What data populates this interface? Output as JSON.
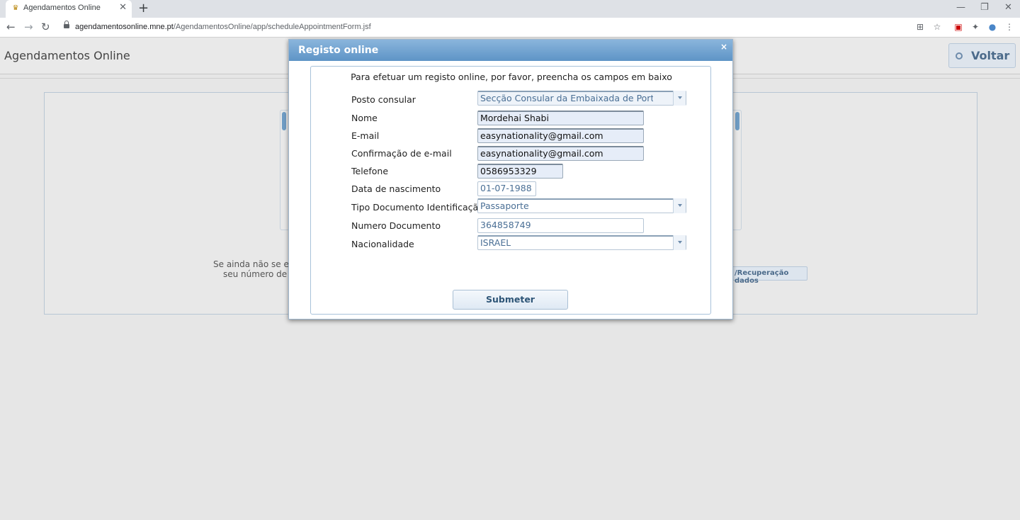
{
  "browser": {
    "tab_title": "Agendamentos Online",
    "tab_close": "✕",
    "new_tab": "+",
    "window_minimize": "—",
    "window_restore": "❐",
    "window_close": "✕",
    "back": "←",
    "forward": "→",
    "reload": "↻",
    "url_domain": "agendamentosonline.mne.pt",
    "url_path": "/AgendamentosOnline/app/scheduleAppointmentForm.jsf",
    "icons": {
      "translate": "⊞",
      "star": "☆",
      "pdf": "▣",
      "puzzle": "✦",
      "profile": "●",
      "menu": "⋮"
    }
  },
  "page": {
    "app_title": "Agendamentos Online",
    "voltar_label": "Voltar",
    "bg_text_line1": "Se ainda não se er",
    "bg_text_line2": "seu número de",
    "bg_button": "/Recuperação dados"
  },
  "modal": {
    "title": "Registo online",
    "close": "×",
    "intro": "Para efetuar um registo online, por favor, preencha os campos em baixo",
    "fields": {
      "posto_consular": {
        "label": "Posto consular",
        "value": "Secção Consular da Embaixada de Portugal"
      },
      "nome": {
        "label": "Nome",
        "value": "Mordehai Shabi"
      },
      "email": {
        "label": "E-mail",
        "value": "easynationality@gmail.com"
      },
      "email_confirm": {
        "label": "Confirmação de e-mail",
        "value": "easynationality@gmail.com"
      },
      "telefone": {
        "label": "Telefone",
        "value": "0586953329"
      },
      "data_nascimento": {
        "label": "Data de nascimento",
        "value": "01-07-1988"
      },
      "tipo_documento": {
        "label": "Tipo Documento Identificação",
        "value": "Passaporte"
      },
      "numero_documento": {
        "label": "Numero Documento",
        "value": "364858749"
      },
      "nacionalidade": {
        "label": "Nacionalidade",
        "value": "ISRAEL"
      }
    },
    "submit_label": "Submeter"
  }
}
